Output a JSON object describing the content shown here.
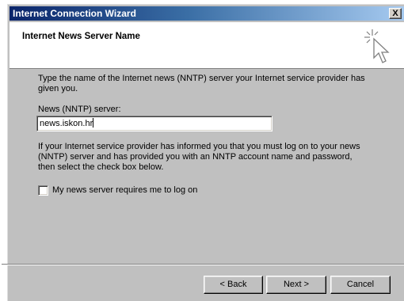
{
  "window": {
    "title": "Internet Connection Wizard",
    "close_label": "X"
  },
  "header": {
    "title": "Internet News Server Name",
    "icon": "wizard-cursor-icon"
  },
  "main": {
    "intro": "Type the name of the Internet news (NNTP) server your Internet service provider has given you.",
    "server_label": "News (NNTP) server:",
    "server_value": "news.iskon.hr",
    "logon_info": "If your Internet service provider has informed you that you must log on to your news (NNTP) server and has provided you with an NNTP account name and password, then select the check box below.",
    "logon_checkbox_label": "My news server requires me to log on",
    "logon_checked": false
  },
  "footer": {
    "back_label": "< Back",
    "next_label": "Next >",
    "cancel_label": "Cancel"
  },
  "colors": {
    "title_bar_start": "#0a246a",
    "title_bar_end": "#a6caf0",
    "dialog_face": "#c0c0c0"
  }
}
